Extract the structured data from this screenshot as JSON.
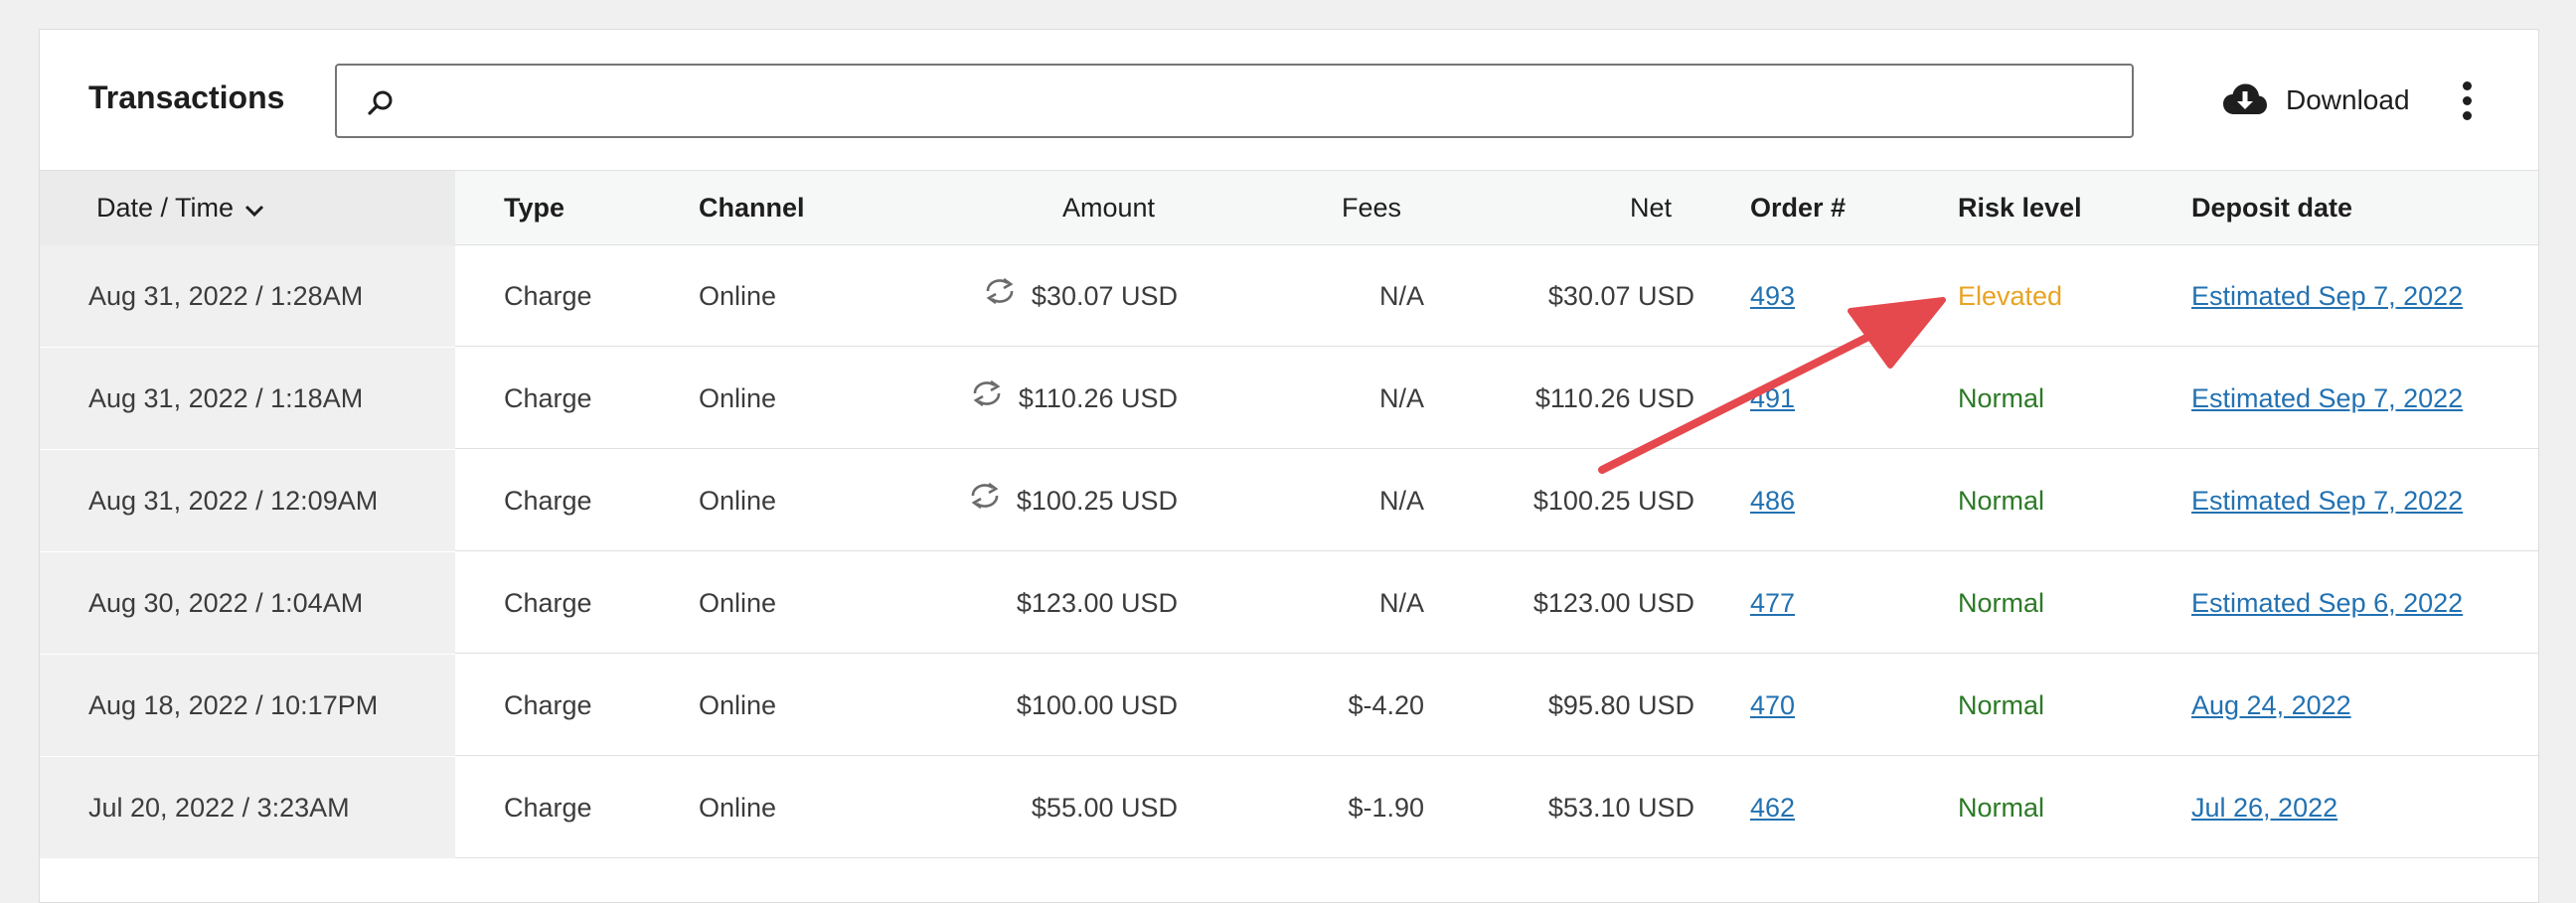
{
  "header": {
    "title": "Transactions",
    "search_value": "",
    "search_placeholder": "",
    "download_label": "Download"
  },
  "columns": {
    "date": "Date / Time",
    "type": "Type",
    "channel": "Channel",
    "amount": "Amount",
    "fees": "Fees",
    "net": "Net",
    "order": "Order #",
    "risk": "Risk level",
    "deposit": "Deposit date"
  },
  "rows": [
    {
      "date": "Aug 31, 2022 / 1:28AM",
      "type": "Charge",
      "channel": "Online",
      "amount": "$30.07 USD",
      "refund_icon": true,
      "fees": "N/A",
      "net": "$30.07 USD",
      "order": "493",
      "risk": "Elevated",
      "deposit": "Estimated Sep 7, 2022"
    },
    {
      "date": "Aug 31, 2022 / 1:18AM",
      "type": "Charge",
      "channel": "Online",
      "amount": "$110.26 USD",
      "refund_icon": true,
      "fees": "N/A",
      "net": "$110.26 USD",
      "order": "491",
      "risk": "Normal",
      "deposit": "Estimated Sep 7, 2022"
    },
    {
      "date": "Aug 31, 2022 / 12:09AM",
      "type": "Charge",
      "channel": "Online",
      "amount": "$100.25 USD",
      "refund_icon": true,
      "fees": "N/A",
      "net": "$100.25 USD",
      "order": "486",
      "risk": "Normal",
      "deposit": "Estimated Sep 7, 2022"
    },
    {
      "date": "Aug 30, 2022 / 1:04AM",
      "type": "Charge",
      "channel": "Online",
      "amount": "$123.00 USD",
      "refund_icon": false,
      "fees": "N/A",
      "net": "$123.00 USD",
      "order": "477",
      "risk": "Normal",
      "deposit": "Estimated Sep 6, 2022"
    },
    {
      "date": "Aug 18, 2022 / 10:17PM",
      "type": "Charge",
      "channel": "Online",
      "amount": "$100.00 USD",
      "refund_icon": false,
      "fees": "$-4.20",
      "net": "$95.80 USD",
      "order": "470",
      "risk": "Normal",
      "deposit": "Aug 24, 2022"
    },
    {
      "date": "Jul 20, 2022 / 3:23AM",
      "type": "Charge",
      "channel": "Online",
      "amount": "$55.00 USD",
      "refund_icon": false,
      "fees": "$-1.90",
      "net": "$53.10 USD",
      "order": "462",
      "risk": "Normal",
      "deposit": "Jul 26, 2022"
    }
  ],
  "colors": {
    "risk_normal": "#2c7a26",
    "risk_elevated": "#e8a323",
    "link": "#2271b1",
    "annotation_arrow": "#e5484d"
  },
  "icons": {
    "search": "search-icon",
    "download": "cloud-download-icon",
    "more": "more-vertical-icon",
    "sort": "chevron-down-icon",
    "refund": "refresh-icon"
  }
}
